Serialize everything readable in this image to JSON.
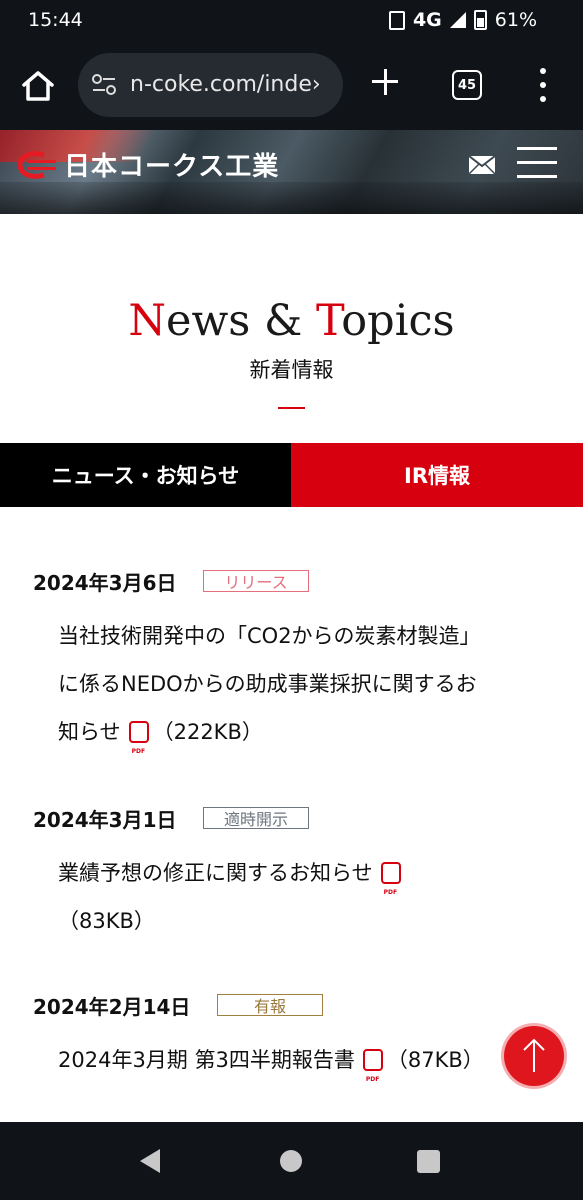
{
  "status_bar": {
    "time": "15:44",
    "network": "4G",
    "battery": "61%"
  },
  "browser": {
    "url": "n-coke.com/inde›",
    "tab_count": "45"
  },
  "site": {
    "logo_text": "日本コークス工業"
  },
  "section": {
    "title_n": "N",
    "title_ews": "ews & ",
    "title_t": "T",
    "title_opics": "opics",
    "subtitle": "新着情報"
  },
  "tabs": {
    "news": "ニュース・お知らせ",
    "ir": "IR情報"
  },
  "items": [
    {
      "date": "2024年3月6日",
      "badge": "リリース",
      "lines": [
        "当社技術開発中の「CO2からの炭素材製造」",
        "に係るNEDOからの助成事業採択に関するお",
        "知らせ"
      ],
      "size": "（222KB）"
    },
    {
      "date": "2024年3月1日",
      "badge": "適時開示",
      "lines": [
        "業績予想の修正に関するお知らせ"
      ],
      "size": "（83KB）"
    },
    {
      "date": "2024年2月14日",
      "badge": "有報",
      "lines": [
        "2024年3月期 第3四半期報告書"
      ],
      "size": "（87KB）"
    }
  ],
  "colors": {
    "accent_red": "#d7000f",
    "dark_bar": "#101418"
  },
  "icons": [
    "home-icon",
    "tune-icon",
    "plus-icon",
    "tabs-icon",
    "more-vert-icon",
    "mail-icon",
    "hamburger-icon",
    "pdf-icon",
    "arrow-up-icon",
    "back-icon",
    "home-nav-icon",
    "recents-icon"
  ]
}
